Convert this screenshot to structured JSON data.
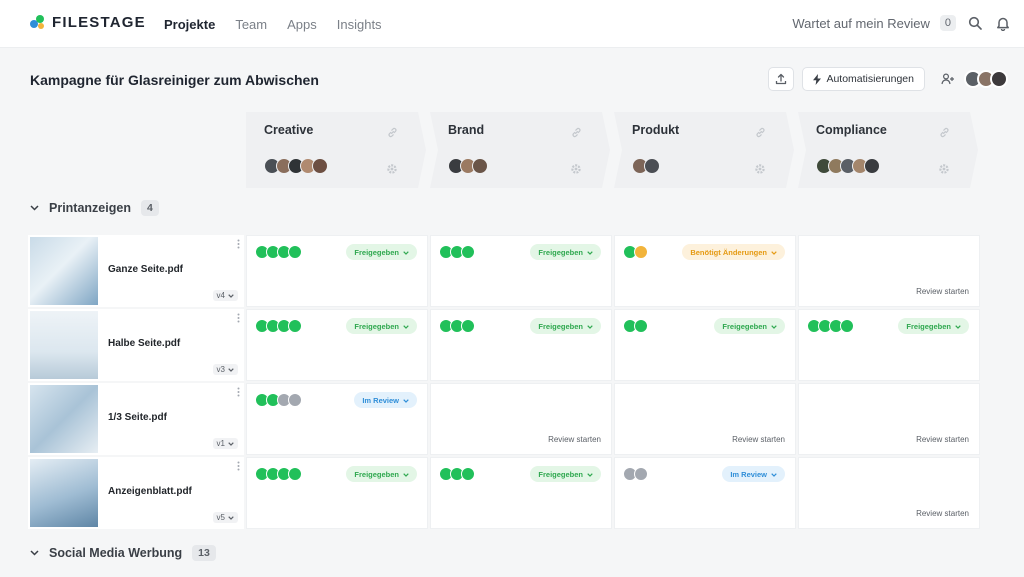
{
  "brand": {
    "name": "FILESTAGE",
    "colors": [
      "#2f8ed8",
      "#21c05a",
      "#f2b43b"
    ]
  },
  "nav": {
    "items": [
      "Projekte",
      "Team",
      "Apps",
      "Insights"
    ],
    "active": "Projekte"
  },
  "waiting": {
    "label": "Wartet auf mein Review",
    "count": "0"
  },
  "project": {
    "title": "Kampagne für Glasreiniger zum Abwischen",
    "automation_label": "Automatisierungen"
  },
  "colors": {
    "approved": "#21c05a",
    "pending": "#f2b43b",
    "none": "#a3a8b0"
  },
  "steps": [
    {
      "name": "Creative"
    },
    {
      "name": "Brand"
    },
    {
      "name": "Produkt"
    },
    {
      "name": "Compliance"
    }
  ],
  "groups": [
    {
      "name": "Printanzeigen",
      "count": "4"
    },
    {
      "name": "Social Media Werbung",
      "count": "13"
    }
  ],
  "files": [
    {
      "name": "Ganze Seite.pdf",
      "version": "v4",
      "reviews": [
        {
          "dots": [
            "approved",
            "approved",
            "approved",
            "approved"
          ],
          "status": "Freigegeben",
          "tone": "green"
        },
        {
          "dots": [
            "approved",
            "approved",
            "approved"
          ],
          "status": "Freigegeben",
          "tone": "green"
        },
        {
          "dots": [
            "approved",
            "pending"
          ],
          "status": "Benötigt Änderungen",
          "tone": "orange"
        },
        {
          "action": "Review starten"
        }
      ]
    },
    {
      "name": "Halbe Seite.pdf",
      "version": "v3",
      "reviews": [
        {
          "dots": [
            "approved",
            "approved",
            "approved",
            "approved"
          ],
          "status": "Freigegeben",
          "tone": "green"
        },
        {
          "dots": [
            "approved",
            "approved",
            "approved"
          ],
          "status": "Freigegeben",
          "tone": "green"
        },
        {
          "dots": [
            "approved",
            "approved"
          ],
          "status": "Freigegeben",
          "tone": "green"
        },
        {
          "dots": [
            "approved",
            "approved",
            "approved",
            "approved"
          ],
          "status": "Freigegeben",
          "tone": "green"
        }
      ]
    },
    {
      "name": "1/3 Seite.pdf",
      "version": "v1",
      "reviews": [
        {
          "dots": [
            "approved",
            "approved",
            "none",
            "none"
          ],
          "status": "Im Review",
          "tone": "blue"
        },
        {
          "action": "Review starten"
        },
        {
          "action": "Review starten"
        },
        {
          "action": "Review starten"
        }
      ]
    },
    {
      "name": "Anzeigenblatt.pdf",
      "version": "v5",
      "reviews": [
        {
          "dots": [
            "approved",
            "approved",
            "approved",
            "approved"
          ],
          "status": "Freigegeben",
          "tone": "green"
        },
        {
          "dots": [
            "approved",
            "approved",
            "approved"
          ],
          "status": "Freigegeben",
          "tone": "green"
        },
        {
          "dots": [
            "none",
            "none"
          ],
          "status": "Im Review",
          "tone": "blue"
        },
        {
          "action": "Review starten"
        }
      ]
    }
  ]
}
